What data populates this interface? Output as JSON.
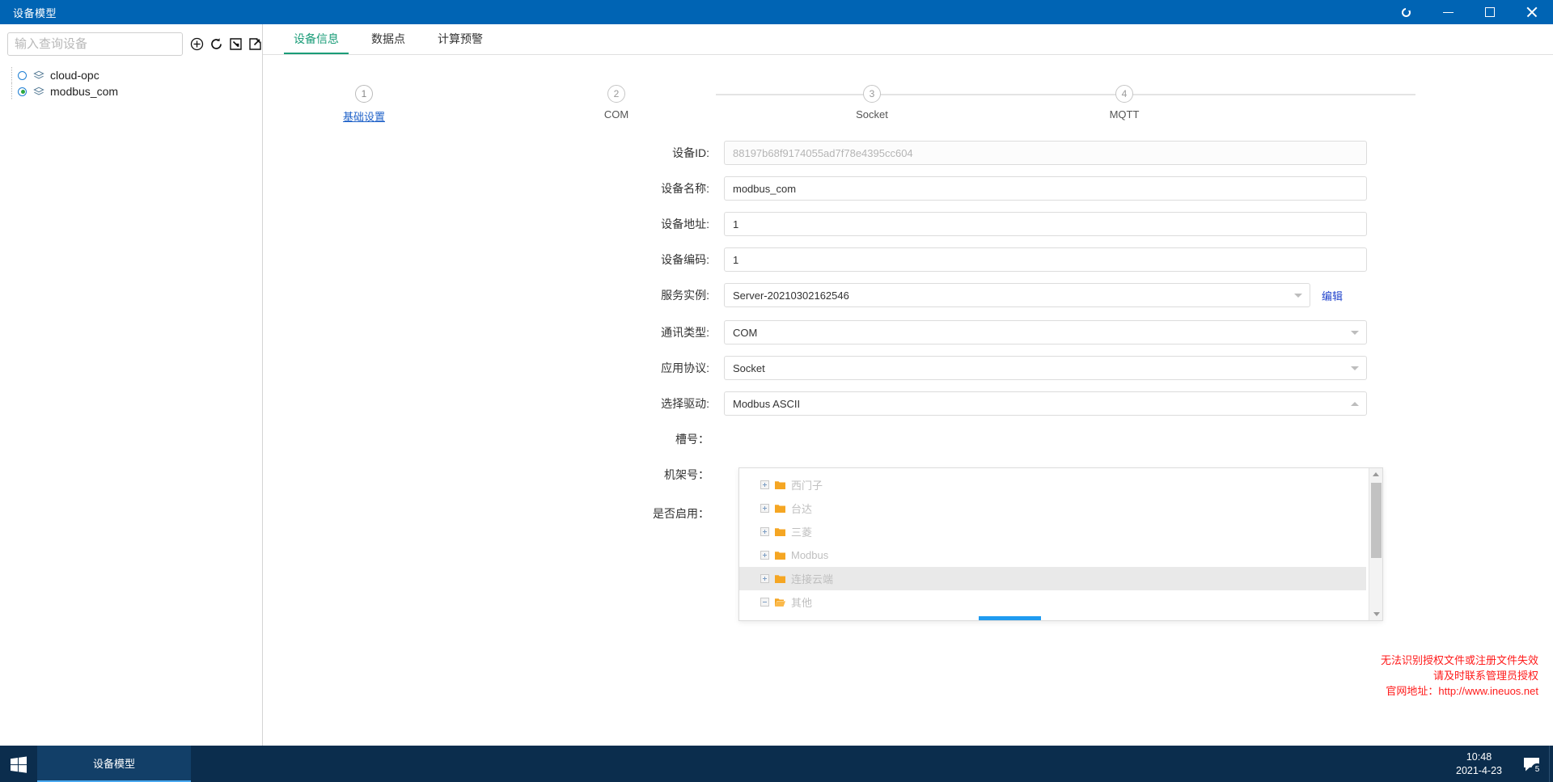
{
  "window": {
    "title": "设备模型",
    "controls": [
      {
        "name": "settings-circle",
        "glyph": "circle"
      },
      {
        "name": "minimize",
        "glyph": "minus"
      },
      {
        "name": "maximize",
        "glyph": "square"
      },
      {
        "name": "close",
        "glyph": "x"
      }
    ]
  },
  "sidebar": {
    "search": {
      "placeholder": "输入查询设备",
      "value": ""
    },
    "tools": [
      {
        "name": "add-device-icon",
        "title": "添加"
      },
      {
        "name": "refresh-icon",
        "title": "刷新"
      },
      {
        "name": "import-icon",
        "title": "导入"
      },
      {
        "name": "export-icon",
        "title": "导出"
      }
    ],
    "tree": [
      {
        "label": "cloud-opc",
        "selected": false
      },
      {
        "label": "modbus_com",
        "selected": true
      }
    ]
  },
  "tabs": [
    {
      "label": "设备信息",
      "active": true
    },
    {
      "label": "数据点",
      "active": false
    },
    {
      "label": "计算预警",
      "active": false
    }
  ],
  "stepper": [
    {
      "num": "1",
      "label": "基础设置",
      "active": true
    },
    {
      "num": "2",
      "label": "COM",
      "active": false
    },
    {
      "num": "3",
      "label": "Socket",
      "active": false
    },
    {
      "num": "4",
      "label": "MQTT",
      "active": false
    }
  ],
  "form": {
    "device_id": {
      "label": "设备ID:",
      "value": "88197b68f9174055ad7f78e4395cc604"
    },
    "device_name": {
      "label": "设备名称:",
      "value": "modbus_com"
    },
    "device_address": {
      "label": "设备地址:",
      "value": "1"
    },
    "device_code": {
      "label": "设备编码:",
      "value": "1"
    },
    "service_instance": {
      "label": "服务实例:",
      "value": "Server-20210302162546",
      "edit_label": "编辑"
    },
    "comm_type": {
      "label": "通讯类型:",
      "value": "COM"
    },
    "app_protocol": {
      "label": "应用协议:",
      "value": "Socket"
    },
    "driver": {
      "label": "选择驱动:",
      "value": "Modbus ASCII"
    },
    "slot_no": {
      "label": "槽号："
    },
    "rack_no": {
      "label": "机架号："
    },
    "enabled": {
      "label": "是否启用："
    }
  },
  "driver_dropdown": {
    "items": [
      {
        "label": "西门子",
        "expanded": false,
        "selected": false
      },
      {
        "label": "台达",
        "expanded": false,
        "selected": false
      },
      {
        "label": "三菱",
        "expanded": false,
        "selected": false
      },
      {
        "label": "Modbus",
        "expanded": false,
        "selected": false
      },
      {
        "label": "连接云端",
        "expanded": false,
        "selected": true
      },
      {
        "label": "其他",
        "expanded": true,
        "selected": false
      }
    ]
  },
  "warning": {
    "line1": "无法识别授权文件或注册文件失效",
    "line2": "请及时联系管理员授权",
    "line3": "官网地址：http://www.ineuos.net",
    "color": "#ff1a1a"
  },
  "taskbar": {
    "start_name": "windows-start",
    "items": [
      {
        "label": "设备模型",
        "active": true
      }
    ],
    "clock": {
      "time": "10:48",
      "date": "2021-4-23"
    },
    "notifications": {
      "count": "5"
    }
  },
  "colors": {
    "titlebar": "#0064b4",
    "tab_active": "#1a9c78",
    "step_active": "#2163c9",
    "taskbar": "#0b2d4d",
    "scroll_accent": "#1f9bf0"
  }
}
